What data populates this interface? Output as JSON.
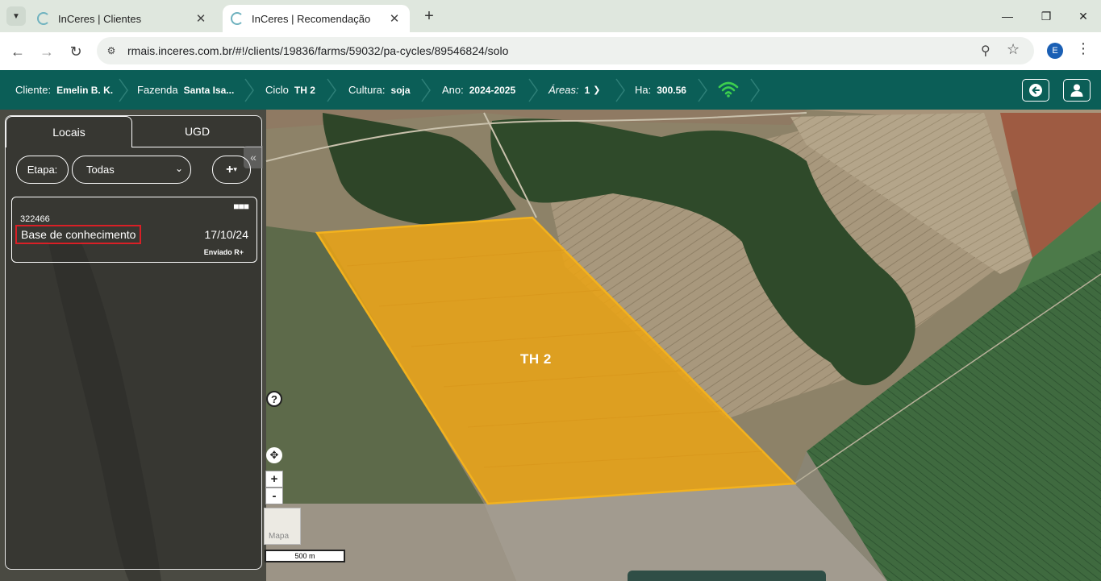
{
  "browser": {
    "tabs": [
      {
        "title": "InCeres | Clientes",
        "active": false
      },
      {
        "title": "InCeres | Recomendação",
        "active": true
      }
    ],
    "url": "rmais.inceres.com.br/#!/clients/19836/farms/59032/pa-cycles/89546824/solo",
    "profile_initial": "E",
    "icons": {
      "tab_menu": "chevron-down-icon",
      "back": "arrow-left-icon",
      "forward": "arrow-right-icon",
      "reload": "reload-icon",
      "site_settings": "tune-icon",
      "zoom": "zoom-icon",
      "bookmark": "star-icon",
      "menu": "kebab-icon"
    }
  },
  "header": {
    "cliente": {
      "label": "Cliente:",
      "value": "Emelin B. K."
    },
    "fazenda": {
      "label": "Fazenda",
      "value": "Santa Isa..."
    },
    "ciclo": {
      "label": "Ciclo",
      "value": "TH 2"
    },
    "cultura": {
      "label": "Cultura:",
      "value": "soja"
    },
    "ano": {
      "label": "Ano:",
      "value": "2024-2025"
    },
    "areas": {
      "label": "Áreas:",
      "value": "1"
    },
    "ha": {
      "label": "Ha:",
      "value": "300.56"
    },
    "colors": {
      "bar": "#0b5e57",
      "wifi": "#3ccf4e"
    }
  },
  "panel": {
    "tabs": [
      "Locais",
      "UGD"
    ],
    "etapa_label": "Etapa:",
    "etapa_selected": "Todas",
    "card": {
      "code": "322466",
      "name": "Base de conhecimento",
      "date": "17/10/24",
      "status": "Enviado R+"
    }
  },
  "map": {
    "field_label": "TH 2",
    "field_color": "#e8a317",
    "controls": {
      "help": "?",
      "zoom_in": "+",
      "zoom_out": "-",
      "layer_label": "Mapa"
    },
    "scale_label": "500 m"
  }
}
